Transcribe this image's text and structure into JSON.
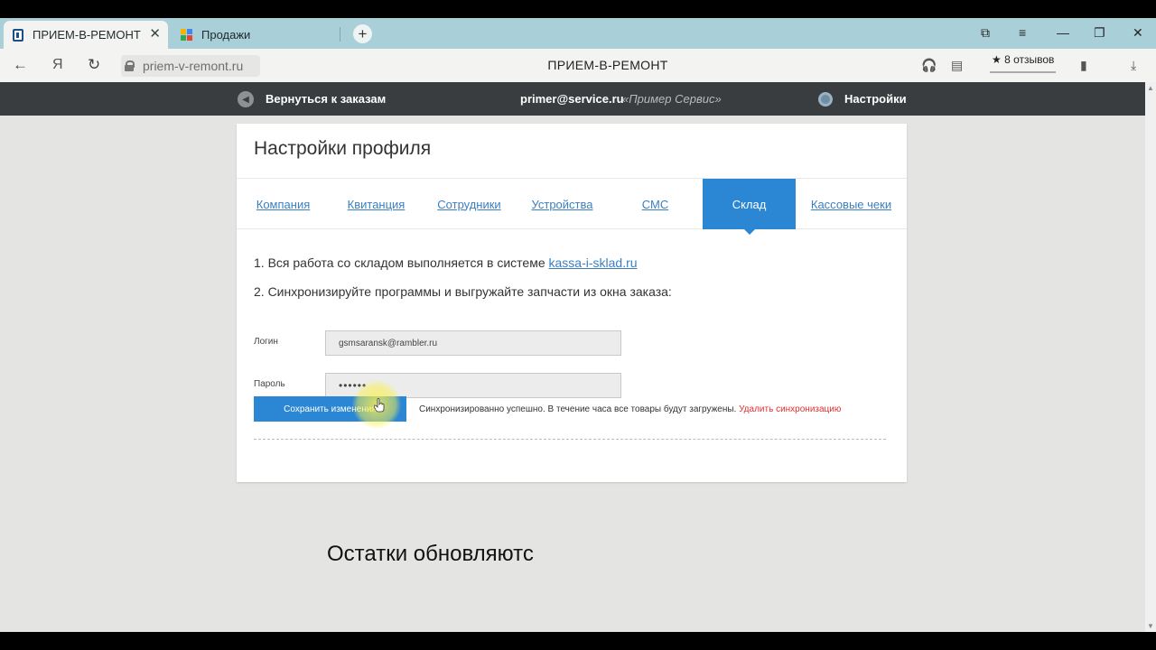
{
  "browser": {
    "tabs": [
      {
        "title": "ПРИЕМ-В-РЕМОНТ",
        "active": true
      },
      {
        "title": "Продажи",
        "active": false
      }
    ],
    "url": "priem-v-remont.ru",
    "page_title": "ПРИЕМ-В-РЕМОНТ",
    "reviews": "★ 8 отзывов",
    "yandex_glyph": "Я"
  },
  "header": {
    "back_label": "Вернуться к заказам",
    "email": "primer@service.ru",
    "company": "«Пример Сервис»",
    "settings_label": "Настройки"
  },
  "main": {
    "title": "Настройки профиля",
    "tabs": [
      {
        "label": "Компания",
        "active": false
      },
      {
        "label": "Квитанция",
        "active": false
      },
      {
        "label": "Сотрудники",
        "active": false
      },
      {
        "label": "Устройства",
        "active": false
      },
      {
        "label": "СМС",
        "active": false
      },
      {
        "label": "Склад",
        "active": true
      },
      {
        "label": "Кассовые чеки",
        "active": false
      }
    ],
    "line1_text": "1. Вся работа со складом выполняется в системе ",
    "line1_link": "kassa-i-sklad.ru",
    "line2_text": "2. Синхронизируйте программы и выгружайте запчасти из окна заказа:",
    "login_label": "Логин",
    "login_value": "gsmsaransk@rambler.ru",
    "password_label": "Пароль",
    "password_value": "••••••",
    "save_label": "Сохранить изменения",
    "status_text": "Синхронизированно успешно. В течение часа все товары будут загружены.",
    "delete_sync": "Удалить синхронизацию"
  },
  "caption": "Остатки обновляютс",
  "colors": {
    "accent": "#2b87d3",
    "link": "#3a7fc1",
    "danger": "#e03030",
    "header_bg": "#3a3d3f"
  }
}
